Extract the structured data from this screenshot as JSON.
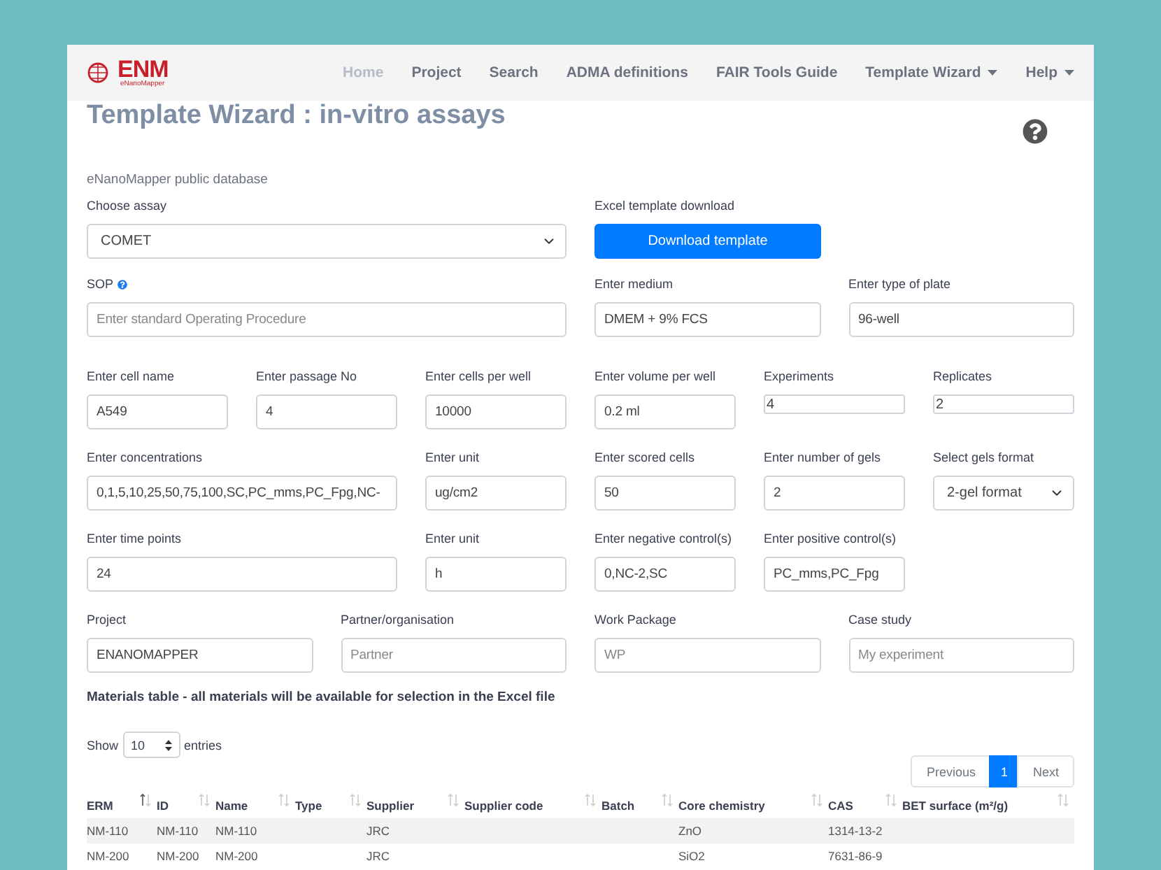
{
  "navbar": {
    "logo": {
      "text": "ENM",
      "subtitle": "eNanoMapper"
    },
    "items": [
      {
        "label": "Home",
        "selected": true,
        "dropdown": false
      },
      {
        "label": "Project",
        "selected": false,
        "dropdown": false
      },
      {
        "label": "Search",
        "selected": false,
        "dropdown": false
      },
      {
        "label": "ADMA definitions",
        "selected": false,
        "dropdown": false
      },
      {
        "label": "FAIR Tools Guide",
        "selected": false,
        "dropdown": false
      },
      {
        "label": "Template Wizard",
        "selected": false,
        "dropdown": true
      },
      {
        "label": "Help",
        "selected": false,
        "dropdown": true
      }
    ]
  },
  "page": {
    "title": "Template Wizard : in-vitro assays",
    "database": "eNanoMapper public database"
  },
  "form_rows": [
    [
      {
        "kind": "select",
        "label": "Choose assay",
        "value": "COMET"
      },
      {
        "kind": "button",
        "label": "Excel template download",
        "button": "Download template"
      }
    ],
    [
      {
        "kind": "input",
        "label": "SOP",
        "info": true,
        "placeholder": "Enter standard Operating Procedure"
      },
      {
        "kind": "input",
        "label": "Enter medium",
        "value": "DMEM + 9% FCS"
      },
      {
        "kind": "input",
        "label": "Enter type of plate",
        "value": "96-well"
      }
    ],
    [
      {
        "kind": "input",
        "label": "Enter cell name",
        "value": "A549"
      },
      {
        "kind": "input",
        "label": "Enter passage No",
        "value": "4"
      },
      {
        "kind": "input",
        "label": "Enter cells per well",
        "value": "10000"
      },
      {
        "kind": "input",
        "label": "Enter volume per well",
        "value": "0.2 ml"
      },
      {
        "kind": "compact",
        "label": "Experiments",
        "value": "4"
      },
      {
        "kind": "compact",
        "label": "Replicates",
        "value": "2"
      }
    ],
    [
      {
        "kind": "input",
        "label": "Enter concentrations",
        "value": "0,1,5,10,25,50,75,100,SC,PC_mms,PC_Fpg,NC-"
      },
      {
        "kind": "input",
        "label": "Enter unit",
        "value": "ug/cm2"
      },
      {
        "kind": "input",
        "label": "Enter scored cells",
        "value": "50"
      },
      {
        "kind": "input",
        "label": "Enter number of gels",
        "value": "2"
      },
      {
        "kind": "select",
        "label": "Select gels format",
        "value": "2-gel format"
      }
    ],
    [
      {
        "kind": "input",
        "label": "Enter time points",
        "value": "24"
      },
      {
        "kind": "input",
        "label": "Enter unit",
        "value": "h"
      },
      {
        "kind": "input",
        "label": "Enter negative control(s)",
        "value": "0,NC-2,SC"
      },
      {
        "kind": "input",
        "label": "Enter positive control(s)",
        "value": "PC_mms,PC_Fpg"
      }
    ],
    [
      {
        "kind": "input",
        "label": "Project",
        "value": "ENANOMAPPER"
      },
      {
        "kind": "input",
        "label": "Partner/organisation",
        "placeholder": "Partner"
      },
      {
        "kind": "input",
        "label": "Work Package",
        "placeholder": "WP"
      },
      {
        "kind": "input",
        "label": "Case study",
        "placeholder": "My experiment"
      }
    ]
  ],
  "materials": {
    "heading": "Materials table - all materials will be available for selection in the Excel file",
    "show_label": "Show",
    "page_size": "10",
    "entries_label": "entries",
    "pagination": {
      "previous": "Previous",
      "pages": [
        {
          "label": "1",
          "selected": true
        }
      ],
      "next": "Next"
    },
    "columns": [
      {
        "label": "ERM",
        "sorted": true
      },
      {
        "label": "ID",
        "sorted": false
      },
      {
        "label": "Name",
        "sorted": false
      },
      {
        "label": "Type",
        "sorted": false
      },
      {
        "label": "Supplier",
        "sorted": false
      },
      {
        "label": "Supplier code",
        "sorted": false
      },
      {
        "label": "Batch",
        "sorted": false
      },
      {
        "label": "Core chemistry",
        "sorted": false
      },
      {
        "label": "CAS",
        "sorted": false
      },
      {
        "label": "BET surface (m²/g)",
        "sorted": false
      }
    ],
    "rows": [
      [
        "NM-110",
        "NM-110",
        "NM-110",
        null,
        "JRC",
        null,
        null,
        "ZnO",
        "1314-13-2",
        null
      ],
      [
        "NM-200",
        "NM-200",
        "NM-200",
        null,
        "JRC",
        null,
        null,
        "SiO2",
        "7631-86-9",
        null
      ]
    ]
  }
}
